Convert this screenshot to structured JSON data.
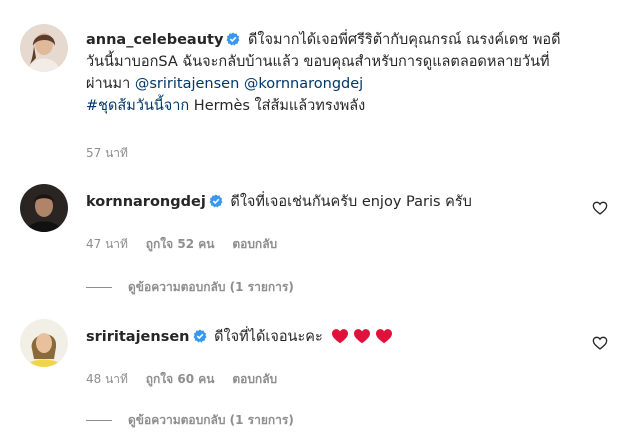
{
  "caption": {
    "username": "anna_celebeauty",
    "line1": "ดีใจมากได้เจอพี่ศรีริต้ากับคุณกรณ์ ณรงค์เดช พอดี",
    "line2": "วันนี้มาบอกSA ฉันจะกลับบ้านแล้ว ขอบคุณสำหรับการดูแลตลอดหลายวันที่",
    "line3": "ผ่านมา",
    "mention1": "@sriritajensen",
    "mention2": "@kornnarongdej",
    "hashtag": "#ชุดส้มวันนี้จาก",
    "hashtag_rest": " Hermès ใส่ส้มแล้วทรงพลัง",
    "time": "57 นาที"
  },
  "comments": [
    {
      "username": "kornnarongdej",
      "text": "ดีใจที่เจอเช่นกันครับ enjoy Paris ครับ",
      "time": "47 นาที",
      "likes": "ถูกใจ 52 คน",
      "reply": "ตอบกลับ",
      "view_replies": "ดูข้อความตอบกลับ (1 รายการ)"
    },
    {
      "username": "sriritajensen",
      "text": "ดีใจที่ได้เจอนะคะ",
      "time": "48 นาที",
      "likes": "ถูกใจ 60 คน",
      "reply": "ตอบกลับ",
      "view_replies": "ดูข้อความตอบกลับ (1 รายการ)",
      "emoji_hearts": 3
    }
  ],
  "colors": {
    "verified": "#3897f0",
    "link": "#00376b",
    "meta": "#8e8e8e",
    "heart_emoji": "#e0113a"
  }
}
